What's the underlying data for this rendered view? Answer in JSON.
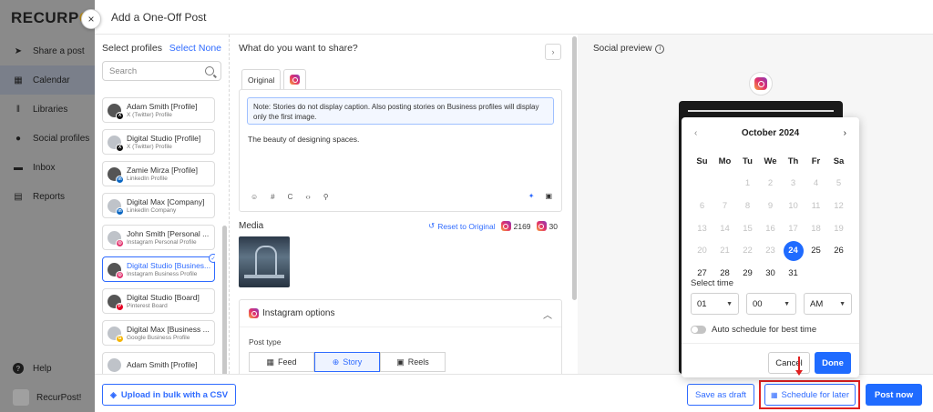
{
  "app": {
    "logo_text": "RECURP",
    "logo_tail": "O",
    "nav": [
      {
        "label": "Share a post",
        "icon": "send-icon"
      },
      {
        "label": "Calendar",
        "icon": "calendar-icon",
        "active": true
      },
      {
        "label": "Libraries",
        "icon": "library-icon"
      },
      {
        "label": "Social profiles",
        "icon": "user-circle-icon"
      },
      {
        "label": "Inbox",
        "icon": "inbox-icon"
      },
      {
        "label": "Reports",
        "icon": "report-icon"
      }
    ],
    "help_label": "Help",
    "account_label": "RecurPost!"
  },
  "modal": {
    "title": "Add a One-Off Post",
    "close_glyph": "×"
  },
  "profiles": {
    "heading": "Select profiles",
    "select_none": "Select None",
    "search_placeholder": "Search",
    "items": [
      {
        "name": "Adam Smith [Profile]",
        "type": "X (Twitter) Profile",
        "network": "x",
        "selected": false
      },
      {
        "name": "Digital Studio [Profile]",
        "type": "X (Twitter) Profile",
        "network": "x",
        "selected": false
      },
      {
        "name": "Zamie Mirza [Profile]",
        "type": "LinkedIn Profile",
        "network": "linkedin",
        "selected": false
      },
      {
        "name": "Digital Max [Company]",
        "type": "LinkedIn Company",
        "network": "linkedin",
        "selected": false
      },
      {
        "name": "John Smith [Personal ...",
        "type": "Instagram Personal Profile",
        "network": "instagram",
        "selected": false
      },
      {
        "name": "Digital Studio [Busines...",
        "type": "Instagram Business Profile",
        "network": "instagram",
        "selected": true
      },
      {
        "name": "Digital Studio [Board]",
        "type": "Pinterest Board",
        "network": "pinterest",
        "selected": false
      },
      {
        "name": "Digital Max [Business ...",
        "type": "Google Business Profile",
        "network": "google",
        "selected": false
      },
      {
        "name": "Adam Smith [Profile]",
        "type": "",
        "network": "x",
        "selected": false
      }
    ]
  },
  "compose": {
    "heading": "What do you want to share?",
    "tab_original": "Original",
    "note": "Note: Stories do not display caption. Also posting stories on Business profiles will display only the first image.",
    "body": "The beauty of designing spaces.",
    "media_label": "Media",
    "reset_label": "Reset to Original",
    "instagram_count": "2169",
    "hashtag_count": "30",
    "ig_options_label": "Instagram options",
    "post_type_label": "Post type",
    "post_types": [
      {
        "label": "Feed",
        "icon": "grid-icon",
        "active": false
      },
      {
        "label": "Story",
        "icon": "story-icon",
        "active": true
      },
      {
        "label": "Reels",
        "icon": "reels-icon",
        "active": false
      }
    ]
  },
  "preview": {
    "heading": "Social preview",
    "info_glyph": "i"
  },
  "calendar": {
    "month": "October 2024",
    "prev_glyph": "‹",
    "next_glyph": "›",
    "weekdays": [
      "Su",
      "Mo",
      "Tu",
      "We",
      "Th",
      "Fr",
      "Sa"
    ],
    "weeks": [
      [
        "",
        "",
        "1",
        "2",
        "3",
        "4",
        "5"
      ],
      [
        "6",
        "7",
        "8",
        "9",
        "10",
        "11",
        "12"
      ],
      [
        "13",
        "14",
        "15",
        "16",
        "17",
        "18",
        "19"
      ],
      [
        "20",
        "21",
        "22",
        "23",
        "24",
        "25",
        "26"
      ],
      [
        "27",
        "28",
        "29",
        "30",
        "31",
        "",
        ""
      ]
    ],
    "today": "24",
    "disabled_before": 24,
    "select_time_label": "Select time",
    "hour": "01",
    "minute": "00",
    "ampm": "AM",
    "auto_schedule_label": "Auto schedule for best time",
    "cancel_label": "Cancel",
    "done_label": "Done"
  },
  "footer": {
    "bulk_label": "Upload in bulk with a CSV",
    "draft_label": "Save as draft",
    "schedule_label": "Schedule for later",
    "post_now_label": "Post now"
  },
  "colors": {
    "accent": "#1f6bff",
    "highlight": "#e02020"
  }
}
